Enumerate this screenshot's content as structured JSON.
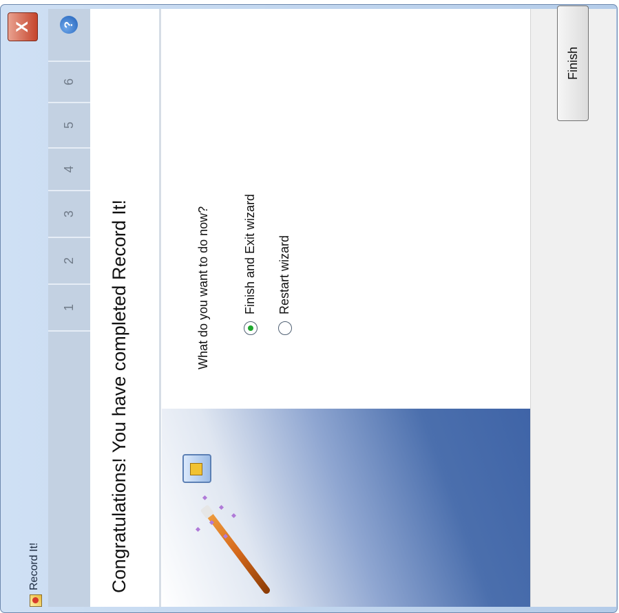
{
  "window": {
    "title": "Record It!",
    "close_label": "X"
  },
  "header": {
    "steps": [
      "1",
      "2",
      "3",
      "4",
      "5",
      "6"
    ],
    "help_label": "?"
  },
  "main": {
    "heading": "Congratulations! You have completed Record It!",
    "question": "What do you want to do now?",
    "options": [
      {
        "label": "Finish and Exit wizard",
        "selected": true
      },
      {
        "label": "Restart wizard",
        "selected": false
      }
    ]
  },
  "footer": {
    "finish_label": "Finish"
  },
  "icons": [
    "app-icon",
    "close-icon",
    "help-icon",
    "magic-wand-icon",
    "recorder-icon",
    "radio-icon"
  ],
  "colors": {
    "accent": "#3f64a7",
    "selected_radio": "#1ea82e",
    "close_button": "#c5442c"
  }
}
